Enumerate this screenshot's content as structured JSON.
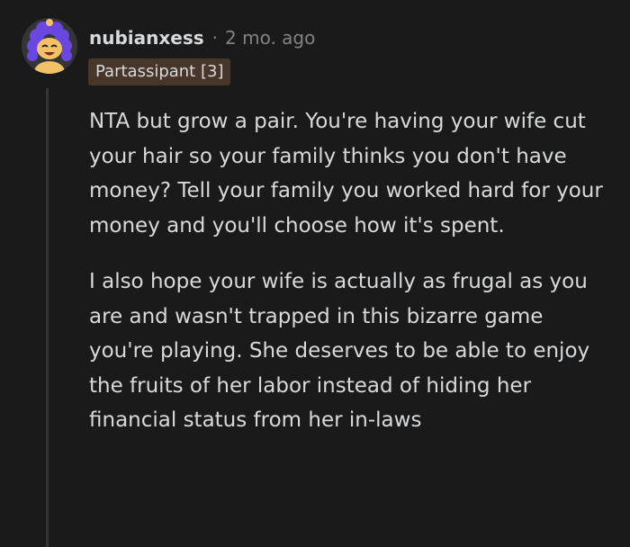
{
  "comment": {
    "username": "nubianxess",
    "separator": "·",
    "timestamp": "2 mo. ago",
    "flair": "Partassipant [3]",
    "paragraphs": [
      "NTA but grow a pair. You're having your wife cut your hair so your family thinks you don't have money? Tell your family you worked hard for your money and you'll choose how it's spent.",
      "I also hope your wife is actually as frugal as you are and wasn't trapped in this bizarre game you're playing. She deserves to be able to enjoy the fruits of her labor instead of hiding her financial status from her in-laws"
    ]
  },
  "colors": {
    "background": "#1a1a1b",
    "text": "#d7dadc",
    "muted": "#818384",
    "flair_bg": "#49362a",
    "avatar_hair": "#6a47e0",
    "avatar_face": "#f3c267"
  },
  "icons": {
    "avatar": "snoo-avatar-icon"
  }
}
